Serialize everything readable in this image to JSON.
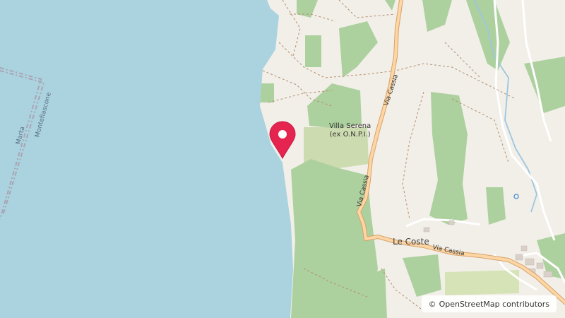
{
  "map": {
    "labels": {
      "village": "Le Coste",
      "poi_line1": "Villa Serena",
      "poi_line2": "(ex O.N.P.I.)",
      "road_1": "Via Cassia",
      "road_2": "Via Cassia",
      "road_3": "Via Cassia",
      "boundary_left": "Marta",
      "boundary_right": "Montefiascone"
    },
    "marker": {
      "icon": "map-pin-icon",
      "color": "#e5244f"
    },
    "attribution": {
      "symbol": "©",
      "text": "OpenStreetMap contributors"
    },
    "colors": {
      "water": "#aad3df",
      "land": "#f2efe9",
      "forest": "#add19e",
      "meadow": "#c8d7ab",
      "road_primary": "#fcd6a4",
      "road_casing": "#d9a26a",
      "waterway": "#9cc6e0"
    }
  }
}
